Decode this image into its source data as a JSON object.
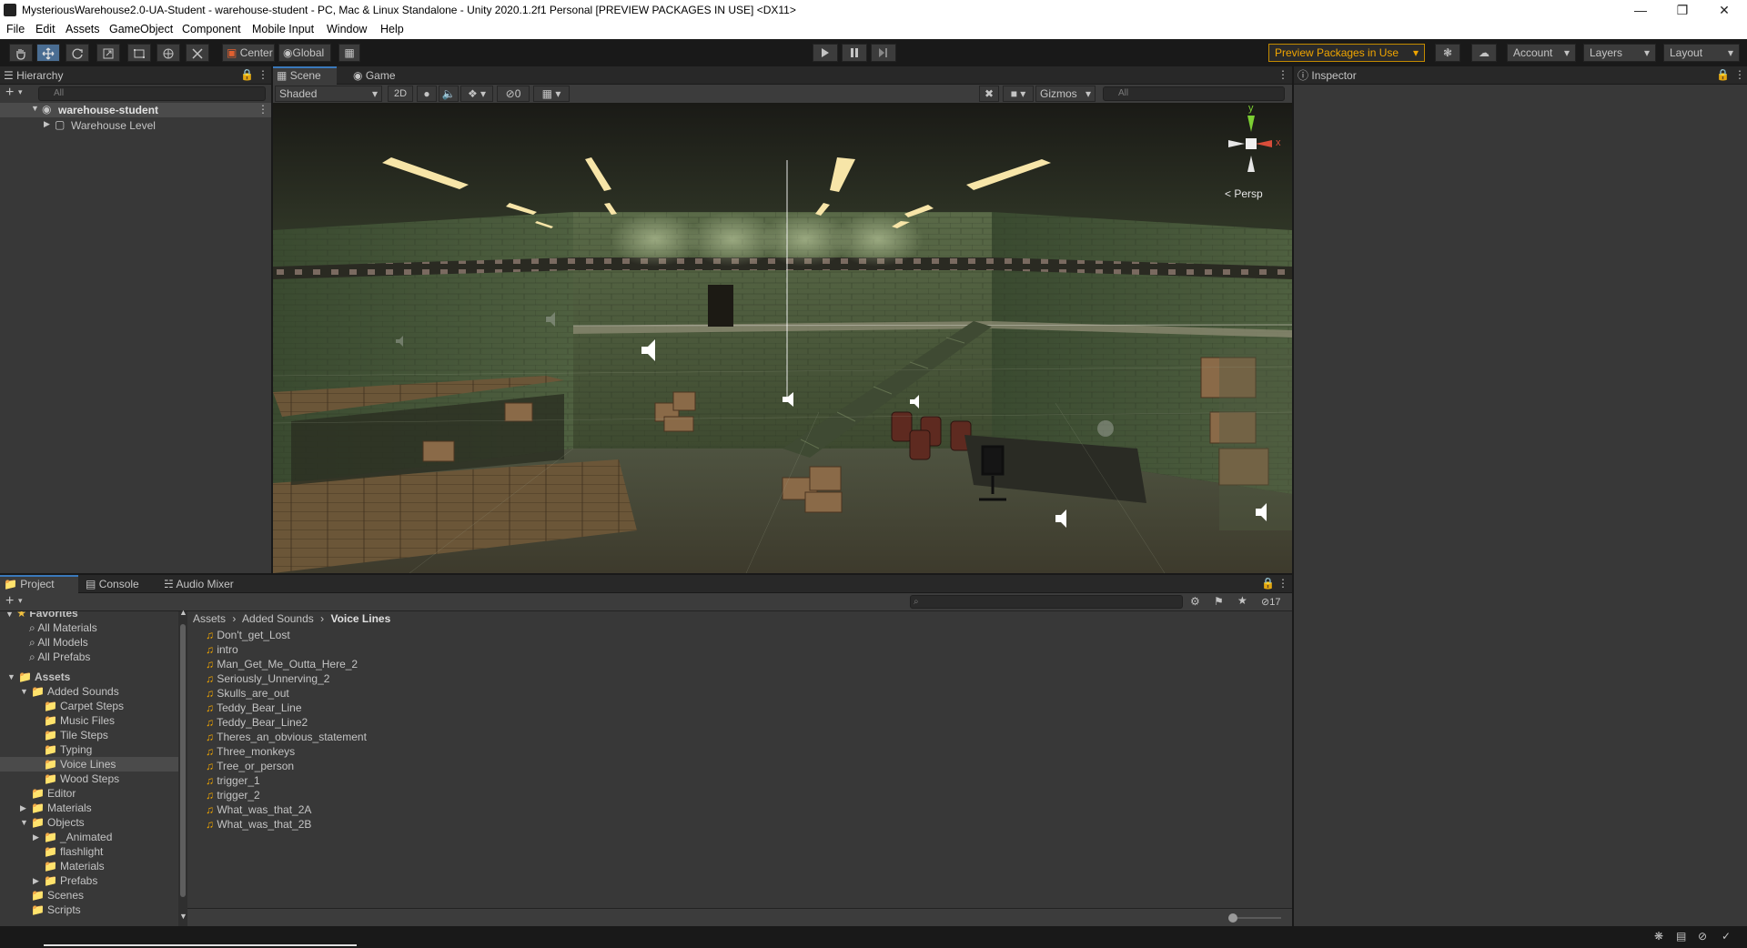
{
  "window": {
    "title": "MysteriousWarehouse2.0-UA-Student - warehouse-student - PC, Mac & Linux Standalone - Unity 2020.1.2f1 Personal [PREVIEW PACKAGES IN USE] <DX11>"
  },
  "menu": [
    "File",
    "Edit",
    "Assets",
    "GameObject",
    "Component",
    "Mobile Input",
    "Window",
    "Help"
  ],
  "toolbar": {
    "pivot_label": "Center",
    "space_label": "Global",
    "preview_packages_label": "Preview Packages in Use",
    "account_label": "Account",
    "layers_label": "Layers",
    "layout_label": "Layout"
  },
  "hierarchy": {
    "tab": "Hierarchy",
    "search_placeholder": "All",
    "scene_name": "warehouse-student",
    "items": [
      "Warehouse Level"
    ]
  },
  "scene": {
    "tabs": [
      "Scene",
      "Game"
    ],
    "shading_mode": "Shaded",
    "mode_2d": "2D",
    "hidden_count": "0",
    "gizmos_label": "Gizmos",
    "search_placeholder": "All",
    "axis_y": "y",
    "axis_x": "x",
    "projection": "Persp"
  },
  "inspector": {
    "tab": "Inspector"
  },
  "project": {
    "tabs": [
      "Project",
      "Console",
      "Audio Mixer"
    ],
    "hidden_count": "17",
    "breadcrumb": [
      "Assets",
      "Added Sounds",
      "Voice Lines"
    ],
    "favorites_label": "Favorites",
    "favorites": [
      "All Materials",
      "All Models",
      "All Prefabs"
    ],
    "tree": [
      {
        "label": "Assets",
        "depth": 0,
        "arrow": "open",
        "selected": false
      },
      {
        "label": "Added Sounds",
        "depth": 1,
        "arrow": "open",
        "selected": false
      },
      {
        "label": "Carpet Steps",
        "depth": 2,
        "arrow": "none",
        "selected": false
      },
      {
        "label": "Music Files",
        "depth": 2,
        "arrow": "none",
        "selected": false
      },
      {
        "label": "Tile Steps",
        "depth": 2,
        "arrow": "none",
        "selected": false
      },
      {
        "label": "Typing",
        "depth": 2,
        "arrow": "none",
        "selected": false
      },
      {
        "label": "Voice Lines",
        "depth": 2,
        "arrow": "none",
        "selected": true
      },
      {
        "label": "Wood Steps",
        "depth": 2,
        "arrow": "none",
        "selected": false
      },
      {
        "label": "Editor",
        "depth": 1,
        "arrow": "none",
        "selected": false
      },
      {
        "label": "Materials",
        "depth": 1,
        "arrow": "closed",
        "selected": false
      },
      {
        "label": "Objects",
        "depth": 1,
        "arrow": "open",
        "selected": false
      },
      {
        "label": "_Animated",
        "depth": 2,
        "arrow": "closed",
        "selected": false
      },
      {
        "label": "flashlight",
        "depth": 2,
        "arrow": "none",
        "selected": false
      },
      {
        "label": "Materials",
        "depth": 2,
        "arrow": "none",
        "selected": false
      },
      {
        "label": "Prefabs",
        "depth": 2,
        "arrow": "closed",
        "selected": false
      },
      {
        "label": "Scenes",
        "depth": 1,
        "arrow": "none",
        "selected": false
      },
      {
        "label": "Scripts",
        "depth": 1,
        "arrow": "none",
        "selected": false
      }
    ],
    "files": [
      "Don't_get_Lost",
      "intro",
      "Man_Get_Me_Outta_Here_2",
      "Seriously_Unnerving_2",
      "Skulls_are_out",
      "Teddy_Bear_Line",
      "Teddy_Bear_Line2",
      "Theres_an_obvious_statement",
      "Three_monkeys",
      "Tree_or_person",
      "trigger_1",
      "trigger_2",
      "What_was_that_2A",
      "What_was_that_2B"
    ]
  },
  "colors": {
    "accent": "#3a79bb",
    "selection": "#2c5d87",
    "warning": "#f0a500",
    "panel": "#383838"
  }
}
